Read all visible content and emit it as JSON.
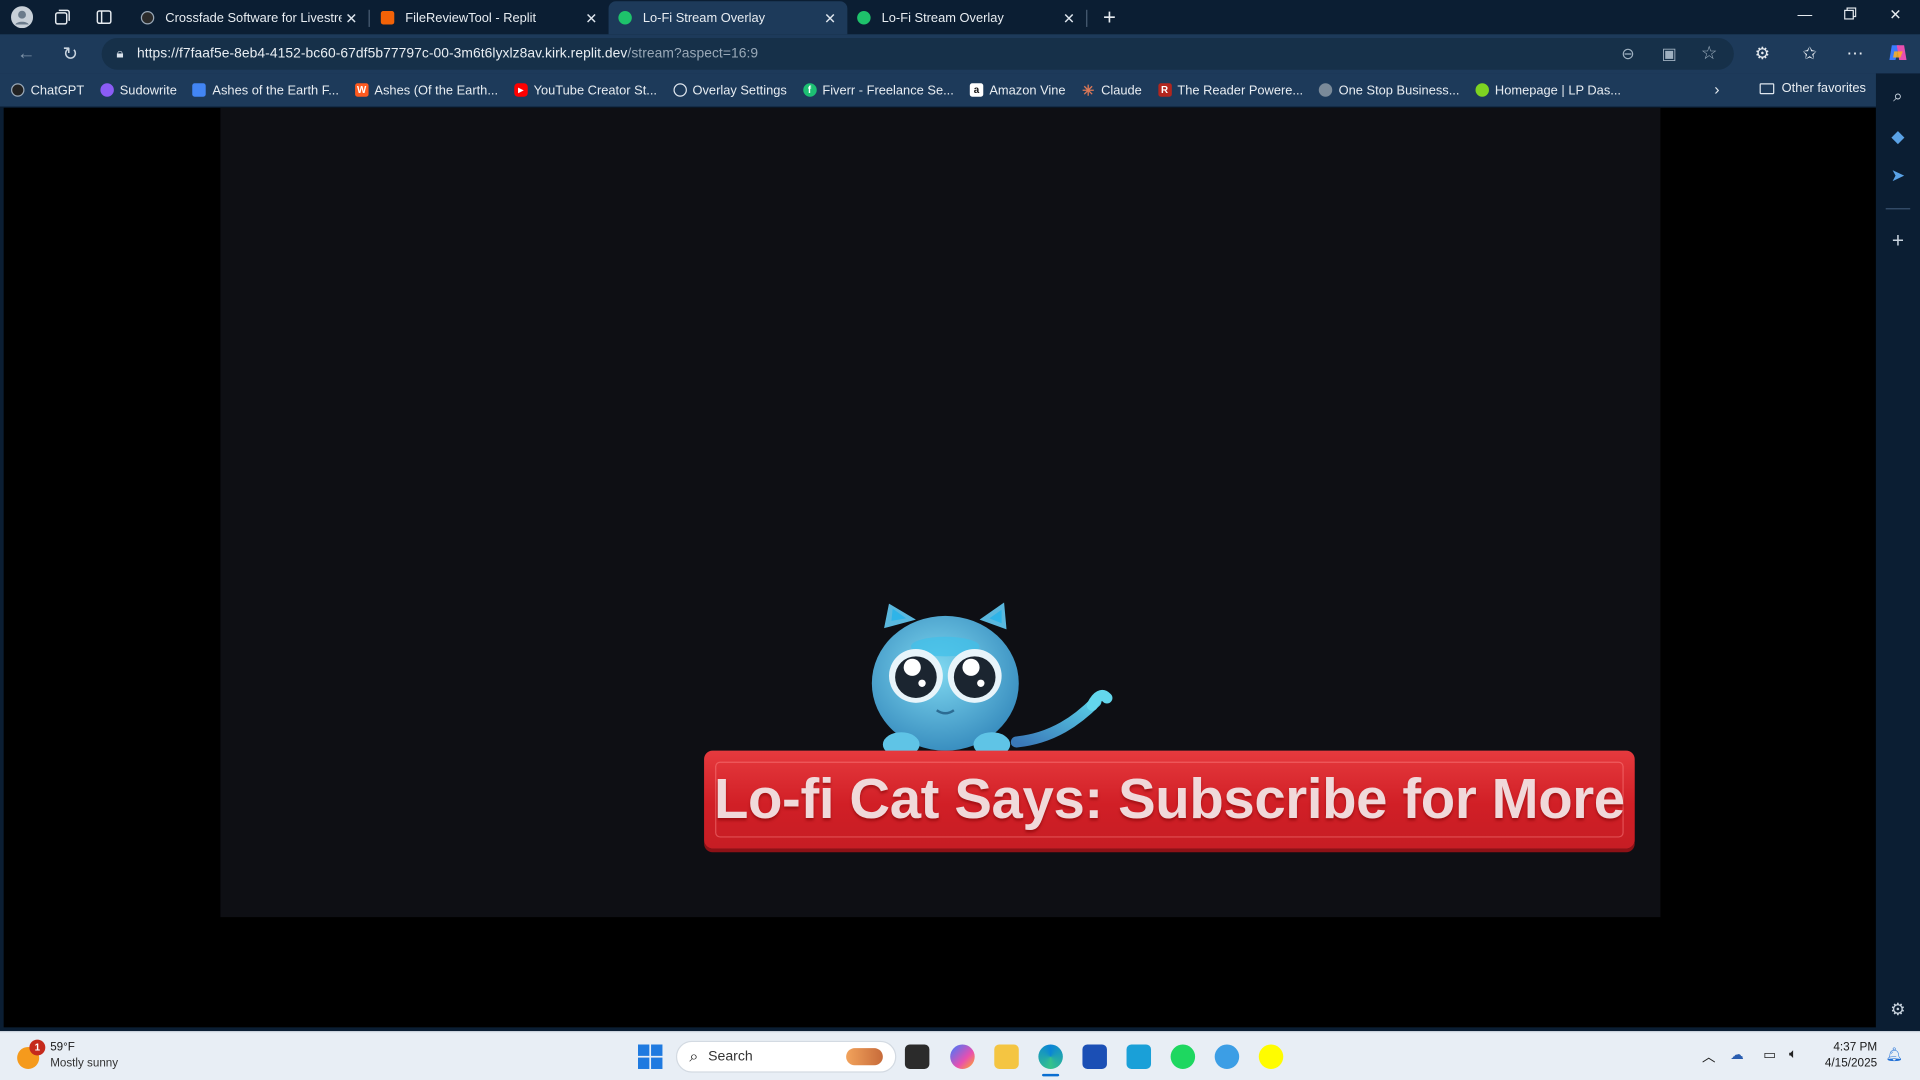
{
  "browser": {
    "tabs": [
      {
        "title": "Crossfade Software for Livestreaming",
        "favicon_color": "#2b2b2b",
        "active": false
      },
      {
        "title": "FileReviewTool - Replit",
        "favicon_color": "#f26207",
        "active": false
      },
      {
        "title": "Lo-Fi Stream Overlay",
        "favicon_color": "#1ec26b",
        "active": true
      },
      {
        "title": "Lo-Fi Stream Overlay",
        "favicon_color": "#1ec26b",
        "active": false
      }
    ],
    "url_main": "https://f7faaf5e-8eb4-4152-bc60-67df5b77797c-00-3m6t6lyxlz8av.kirk.replit.dev",
    "url_path": "/stream?aspect=16:9",
    "bookmarks": [
      {
        "label": "ChatGPT",
        "color": "#222222"
      },
      {
        "label": "Sudowrite",
        "color": "#8b5cf6"
      },
      {
        "label": "Ashes of the Earth F...",
        "color": "#4285f4"
      },
      {
        "label": "Ashes (Of the Earth...",
        "color": "#ff5a1f"
      },
      {
        "label": "YouTube Creator St...",
        "color": "#ff0000"
      },
      {
        "label": "Overlay Settings",
        "color": "#9aa9b8"
      },
      {
        "label": "Fiverr - Freelance Se...",
        "color": "#1dbf73"
      },
      {
        "label": "Amazon Vine",
        "color": "#111111"
      },
      {
        "label": "Claude",
        "color": "#d97757"
      },
      {
        "label": "The Reader Powere...",
        "color": "#b3261e"
      },
      {
        "label": "One Stop Business...",
        "color": "#7a8a99"
      },
      {
        "label": "Homepage | LP Das...",
        "color": "#7ed321"
      }
    ],
    "other_favorites": "Other favorites"
  },
  "overlay": {
    "banner_text": "Lo-fi Cat Says: Subscribe for More",
    "banner_color": "#d9252b"
  },
  "taskbar": {
    "weather_temp": "59°F",
    "weather_desc": "Mostly sunny",
    "weather_badge": "1",
    "search_label": "Search",
    "time": "4:37 PM",
    "date": "4/15/2025"
  }
}
